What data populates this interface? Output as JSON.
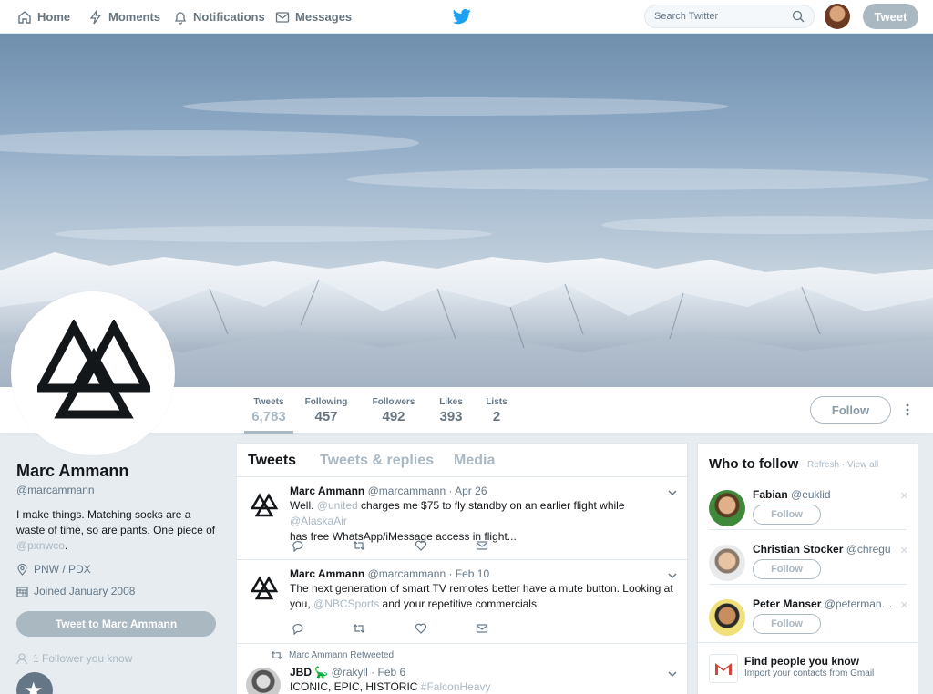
{
  "nav": {
    "home": "Home",
    "moments": "Moments",
    "notifications": "Notifications",
    "messages": "Messages",
    "search_placeholder": "Search Twitter",
    "tweet_button": "Tweet"
  },
  "profile_nav": {
    "stats": [
      {
        "label": "Tweets",
        "value": "6,783"
      },
      {
        "label": "Following",
        "value": "457"
      },
      {
        "label": "Followers",
        "value": "492"
      },
      {
        "label": "Likes",
        "value": "393"
      },
      {
        "label": "Lists",
        "value": "2"
      }
    ],
    "follow_button": "Follow"
  },
  "profile": {
    "name": "Marc Ammann",
    "handle": "@marcammann",
    "bio_line1": "I make things. Matching socks are a",
    "bio_line2": "waste of time, so are pants. One piece of",
    "bio_link": "@pxnwco",
    "bio_end": ".",
    "location": "PNW / PDX",
    "joined": "Joined January 2008",
    "dm_button": "Tweet to Marc Ammann",
    "followers_you_know": "1 Follower you know"
  },
  "timeline": {
    "tabs": [
      "Tweets",
      "Tweets & replies",
      "Media"
    ],
    "tweets": [
      {
        "name": "Marc Ammann",
        "handle": "@marcammann · Apr 26",
        "line1_a": "Well. ",
        "line1_link": "@united",
        "line1_b": " charges me $75 to fly standby on an earlier flight while ",
        "line1_link2": "@AlaskaAir",
        "line2": "has free WhatsApp/iMessage access in flight..."
      },
      {
        "name": "Marc Ammann",
        "handle": "@marcammann · Feb 10",
        "line1": "The next generation of smart TV remotes better have a mute button. Looking at",
        "line2_a": "you, ",
        "line2_link": "@NBCSports",
        "line2_b": " and your repetitive commercials."
      }
    ],
    "retweet": {
      "label": "Marc Ammann Retweeted",
      "name": "JBD",
      "emoji": "🦕",
      "handle": "@rakyll · Feb 6",
      "text": "ICONIC, EPIC, HISTORIC ",
      "hashtag": "#FalconHeavy"
    }
  },
  "who_to_follow": {
    "title": "Who to follow",
    "refresh": "Refresh",
    "view_all": "View all",
    "sep": " · ",
    "suggestions": [
      {
        "name": "Fabian",
        "handle": "@euklid",
        "button": "Follow"
      },
      {
        "name": "Christian Stocker",
        "handle": "@chregu",
        "button": "Follow"
      },
      {
        "name": "Peter Manser",
        "handle": "@peterman…",
        "button": "Follow"
      }
    ],
    "find_title": "Find people you know",
    "find_sub": "Import your contacts from Gmail"
  },
  "colors": {
    "twitter_blue": "#1da1f2",
    "disabled_gray": "#aab8c2",
    "text_dark": "#14171a",
    "text_muted": "#657786"
  }
}
